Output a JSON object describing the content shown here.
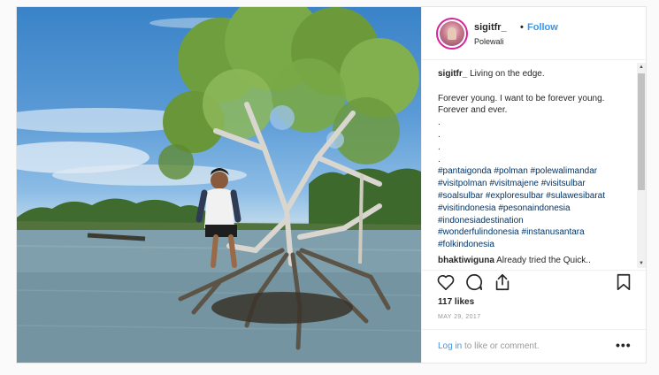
{
  "post": {
    "username": "sigitfr_",
    "separator": "•",
    "follow_label": "Follow",
    "location": "Polewali",
    "caption": {
      "author": "sigitfr_",
      "line1": "Living on the edge.",
      "line2": "Forever young. I want to be forever young.",
      "line3": "Forever and ever.",
      "dots": [
        ".",
        ".",
        ".",
        "."
      ],
      "hashtags": [
        "#pantaigonda #polman #polewalimandar",
        "#visitpolman #visitmajene #visitsulbar",
        "#soalsulbar #exploresulbar #sulawesibarat",
        "#visitindonesia #pesonaindonesia",
        "#indonesiadestination",
        "#wonderfulindonesia #instanusantara",
        "#folkindonesia"
      ]
    },
    "comment": {
      "author": "bhaktiwiguna",
      "text": "Already tried the Quick.."
    },
    "likes": "117 likes",
    "date": "MAY 29, 2017",
    "footer": {
      "login_label": "Log in",
      "login_suffix": "to like or comment.",
      "more_label": "•••"
    }
  },
  "icons": {
    "like": "heart-icon",
    "comment": "comment-icon",
    "share": "share-icon",
    "save": "bookmark-icon",
    "more": "more-options-icon"
  },
  "colors": {
    "link": "#3897f0",
    "hashtag": "#003569",
    "meta": "#999999",
    "text": "#262626",
    "border": "#efefef"
  }
}
